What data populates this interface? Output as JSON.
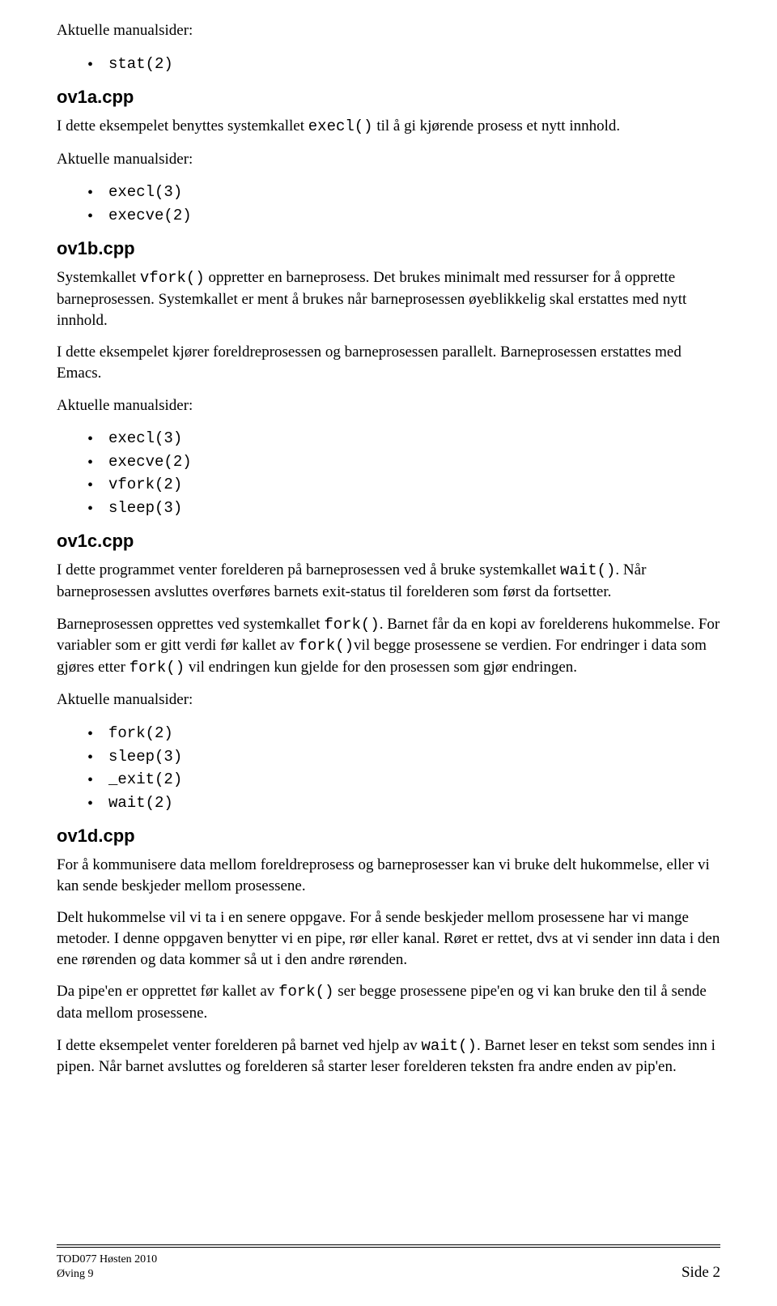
{
  "intro": {
    "label": "Aktuelle manualsider:",
    "items": [
      "stat(2)"
    ]
  },
  "sections": [
    {
      "heading": "ov1a.cpp",
      "paragraphs": [
        {
          "pre": "I dette eksempelet benyttes systemkallet ",
          "code": "execl()",
          "post": " til å gi kjørende prosess et nytt innhold."
        }
      ],
      "listLabel": "Aktuelle manualsider:",
      "items": [
        "execl(3)",
        "execve(2)"
      ]
    },
    {
      "heading": "ov1b.cpp",
      "paragraphs": [
        {
          "pre": "Systemkallet ",
          "code": "vfork()",
          "post": " oppretter en barneprosess. Det brukes minimalt med ressurser for å opprette barneprosessen. Systemkallet er ment å brukes når barneprosessen øyeblikkelig skal erstattes med nytt innhold."
        },
        {
          "pre": "I dette eksempelet kjører foreldreprosessen og barneprosessen parallelt. Barneprosessen erstattes med Emacs.",
          "code": "",
          "post": ""
        }
      ],
      "listLabel": "Aktuelle manualsider:",
      "items": [
        "execl(3)",
        "execve(2)",
        "vfork(2)",
        "sleep(3)"
      ]
    },
    {
      "heading": "ov1c.cpp",
      "paragraphs": [
        {
          "pre": "I dette programmet venter forelderen på barneprosessen ved å bruke systemkallet ",
          "code": "wait()",
          "post": ". Når barneprosessen avsluttes overføres barnets exit-status til forelderen som først da fortsetter."
        },
        {
          "parts": [
            {
              "t": "Barneprosessen opprettes ved systemkallet "
            },
            {
              "c": "fork()"
            },
            {
              "t": ". Barnet får da en kopi av forelderens hukommelse. For variabler som er gitt verdi før kallet av "
            },
            {
              "c": "fork()"
            },
            {
              "t": "vil begge prosessene se verdien. For endringer i data som gjøres etter "
            },
            {
              "c": "fork()"
            },
            {
              "t": " vil endringen kun gjelde for den prosessen som gjør endringen."
            }
          ]
        }
      ],
      "listLabel": "Aktuelle manualsider:",
      "items": [
        "fork(2)",
        "sleep(3)",
        "_exit(2)",
        "wait(2)"
      ]
    },
    {
      "heading": "ov1d.cpp",
      "paragraphs": [
        {
          "pre": "For å kommunisere data mellom foreldreprosess og barneprosesser kan vi bruke delt hukommelse, eller vi kan sende beskjeder mellom prosessene.",
          "code": "",
          "post": ""
        },
        {
          "pre": "Delt hukommelse vil vi ta i en senere oppgave. For å sende beskjeder mellom prosessene har vi mange metoder. I denne oppgaven benytter vi en pipe, rør eller kanal. Røret er rettet, dvs at vi sender inn data i den ene rørenden og data kommer så ut i den andre rørenden.",
          "code": "",
          "post": ""
        },
        {
          "pre": "Da pipe'en er opprettet før kallet av ",
          "code": "fork()",
          "post": " ser begge prosessene pipe'en og vi kan bruke den til å sende data mellom prosessene."
        },
        {
          "pre": "I dette eksempelet venter forelderen på barnet ved hjelp av ",
          "code": "wait()",
          "post": ". Barnet leser en tekst som sendes inn i pipen. Når barnet avsluttes og forelderen så starter leser forelderen teksten fra andre enden av pip'en."
        }
      ],
      "listLabel": "",
      "items": []
    }
  ],
  "footer": {
    "line1": "TOD077 Høsten 2010",
    "line2": "Øving 9",
    "page": "Side 2"
  }
}
